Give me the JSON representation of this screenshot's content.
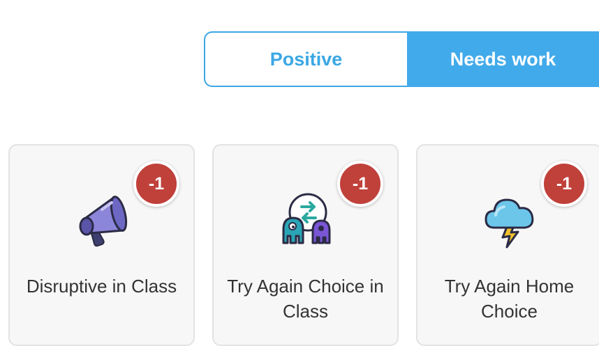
{
  "toggle": {
    "positive_label": "Positive",
    "needs_work_label": "Needs work",
    "selected": "Needs work"
  },
  "colors": {
    "accent": "#41aaea",
    "badge": "#c0403a",
    "card_bg": "#f7f7f7"
  },
  "cards": [
    {
      "label": "Disruptive in Class",
      "points": "-1",
      "icon": "megaphone-icon"
    },
    {
      "label": "Try Again Choice in Class",
      "points": "-1",
      "icon": "monsters-swap-icon"
    },
    {
      "label": "Try Again Home Choice",
      "points": "-1",
      "icon": "storm-cloud-icon"
    }
  ]
}
